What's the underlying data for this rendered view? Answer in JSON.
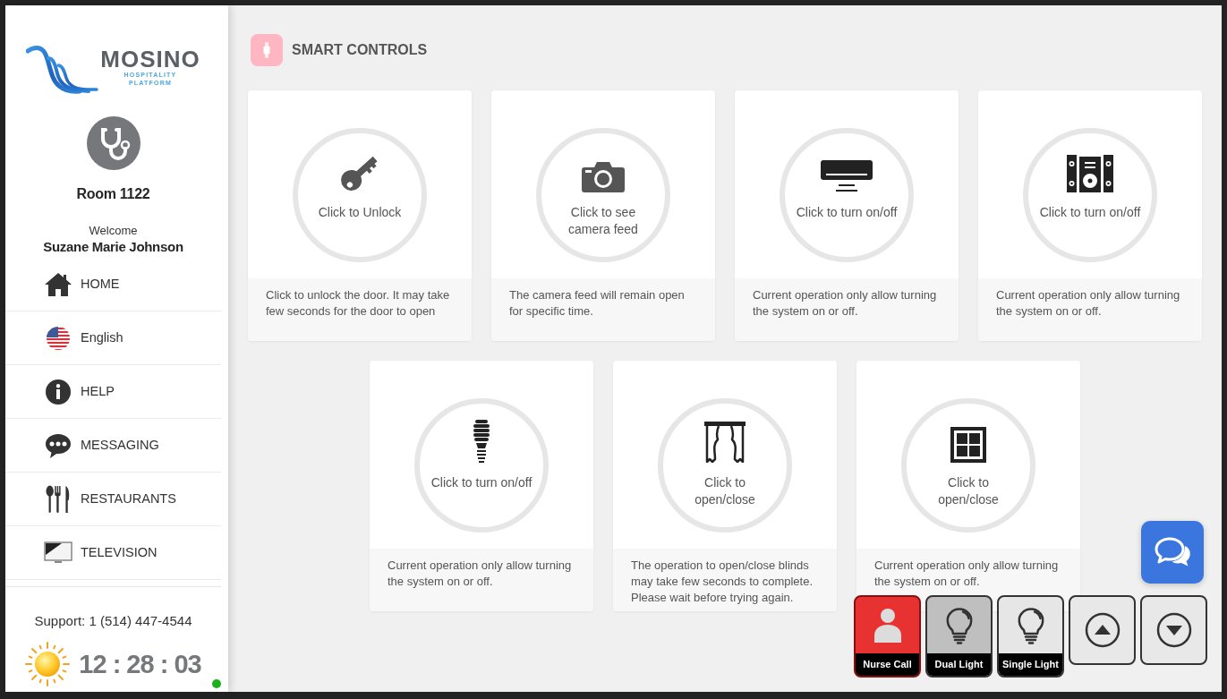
{
  "sidebar": {
    "logo": {
      "wordmark": "MOSINO",
      "tagline": [
        "HOSPITALITY",
        "PLATFORM"
      ]
    },
    "room": "Room 1122",
    "welcome": "Welcome",
    "guest_name": "Suzane Marie Johnson",
    "nav": [
      {
        "kind": "home",
        "label": "HOME"
      },
      {
        "kind": "language",
        "label": "English"
      },
      {
        "kind": "help",
        "label": "HELP"
      },
      {
        "kind": "messaging",
        "label": "MESSAGING"
      },
      {
        "kind": "restaurants",
        "label": "RESTAURANTS"
      },
      {
        "kind": "television",
        "label": "TELEVISION"
      }
    ],
    "support": "Support: 1 (514) 447-4544",
    "clock": "12 : 28 : 03",
    "online": true
  },
  "header": {
    "title": "SMART CONTROLS"
  },
  "controls": [
    {
      "kind": "door_lock",
      "action": "Click to Unlock",
      "description": "Click to unlock the door. It may take\nfew seconds for the door to open"
    },
    {
      "kind": "camera",
      "action": "Click to see\ncamera feed",
      "description": "The camera feed will remain open\nfor specific time."
    },
    {
      "kind": "air_conditioner",
      "action": "Click to turn on/off",
      "description": "Current operation only allow turning\nthe system on or off."
    },
    {
      "kind": "sound_system",
      "action": "Click to turn on/off",
      "description": "Current operation only allow turning\nthe system on or off."
    },
    {
      "kind": "light",
      "action": "Click to turn on/off",
      "description": "Current operation only allow turning\nthe system on or off."
    },
    {
      "kind": "curtains",
      "action": "Click to\nopen/close",
      "description": "The operation to open/close blinds\nmay take few seconds to complete.\nPlease wait before trying again."
    },
    {
      "kind": "window",
      "action": "Click to\nopen/close",
      "description": "Current operation only allow turning\nthe system on or off."
    }
  ],
  "dock": [
    {
      "kind": "nurse_call",
      "label": "Nurse Call"
    },
    {
      "kind": "light",
      "label": "Dual Light",
      "on": true
    },
    {
      "kind": "light",
      "label": "Single Light",
      "on": false
    },
    {
      "kind": "scroll_up"
    },
    {
      "kind": "scroll_down"
    }
  ]
}
